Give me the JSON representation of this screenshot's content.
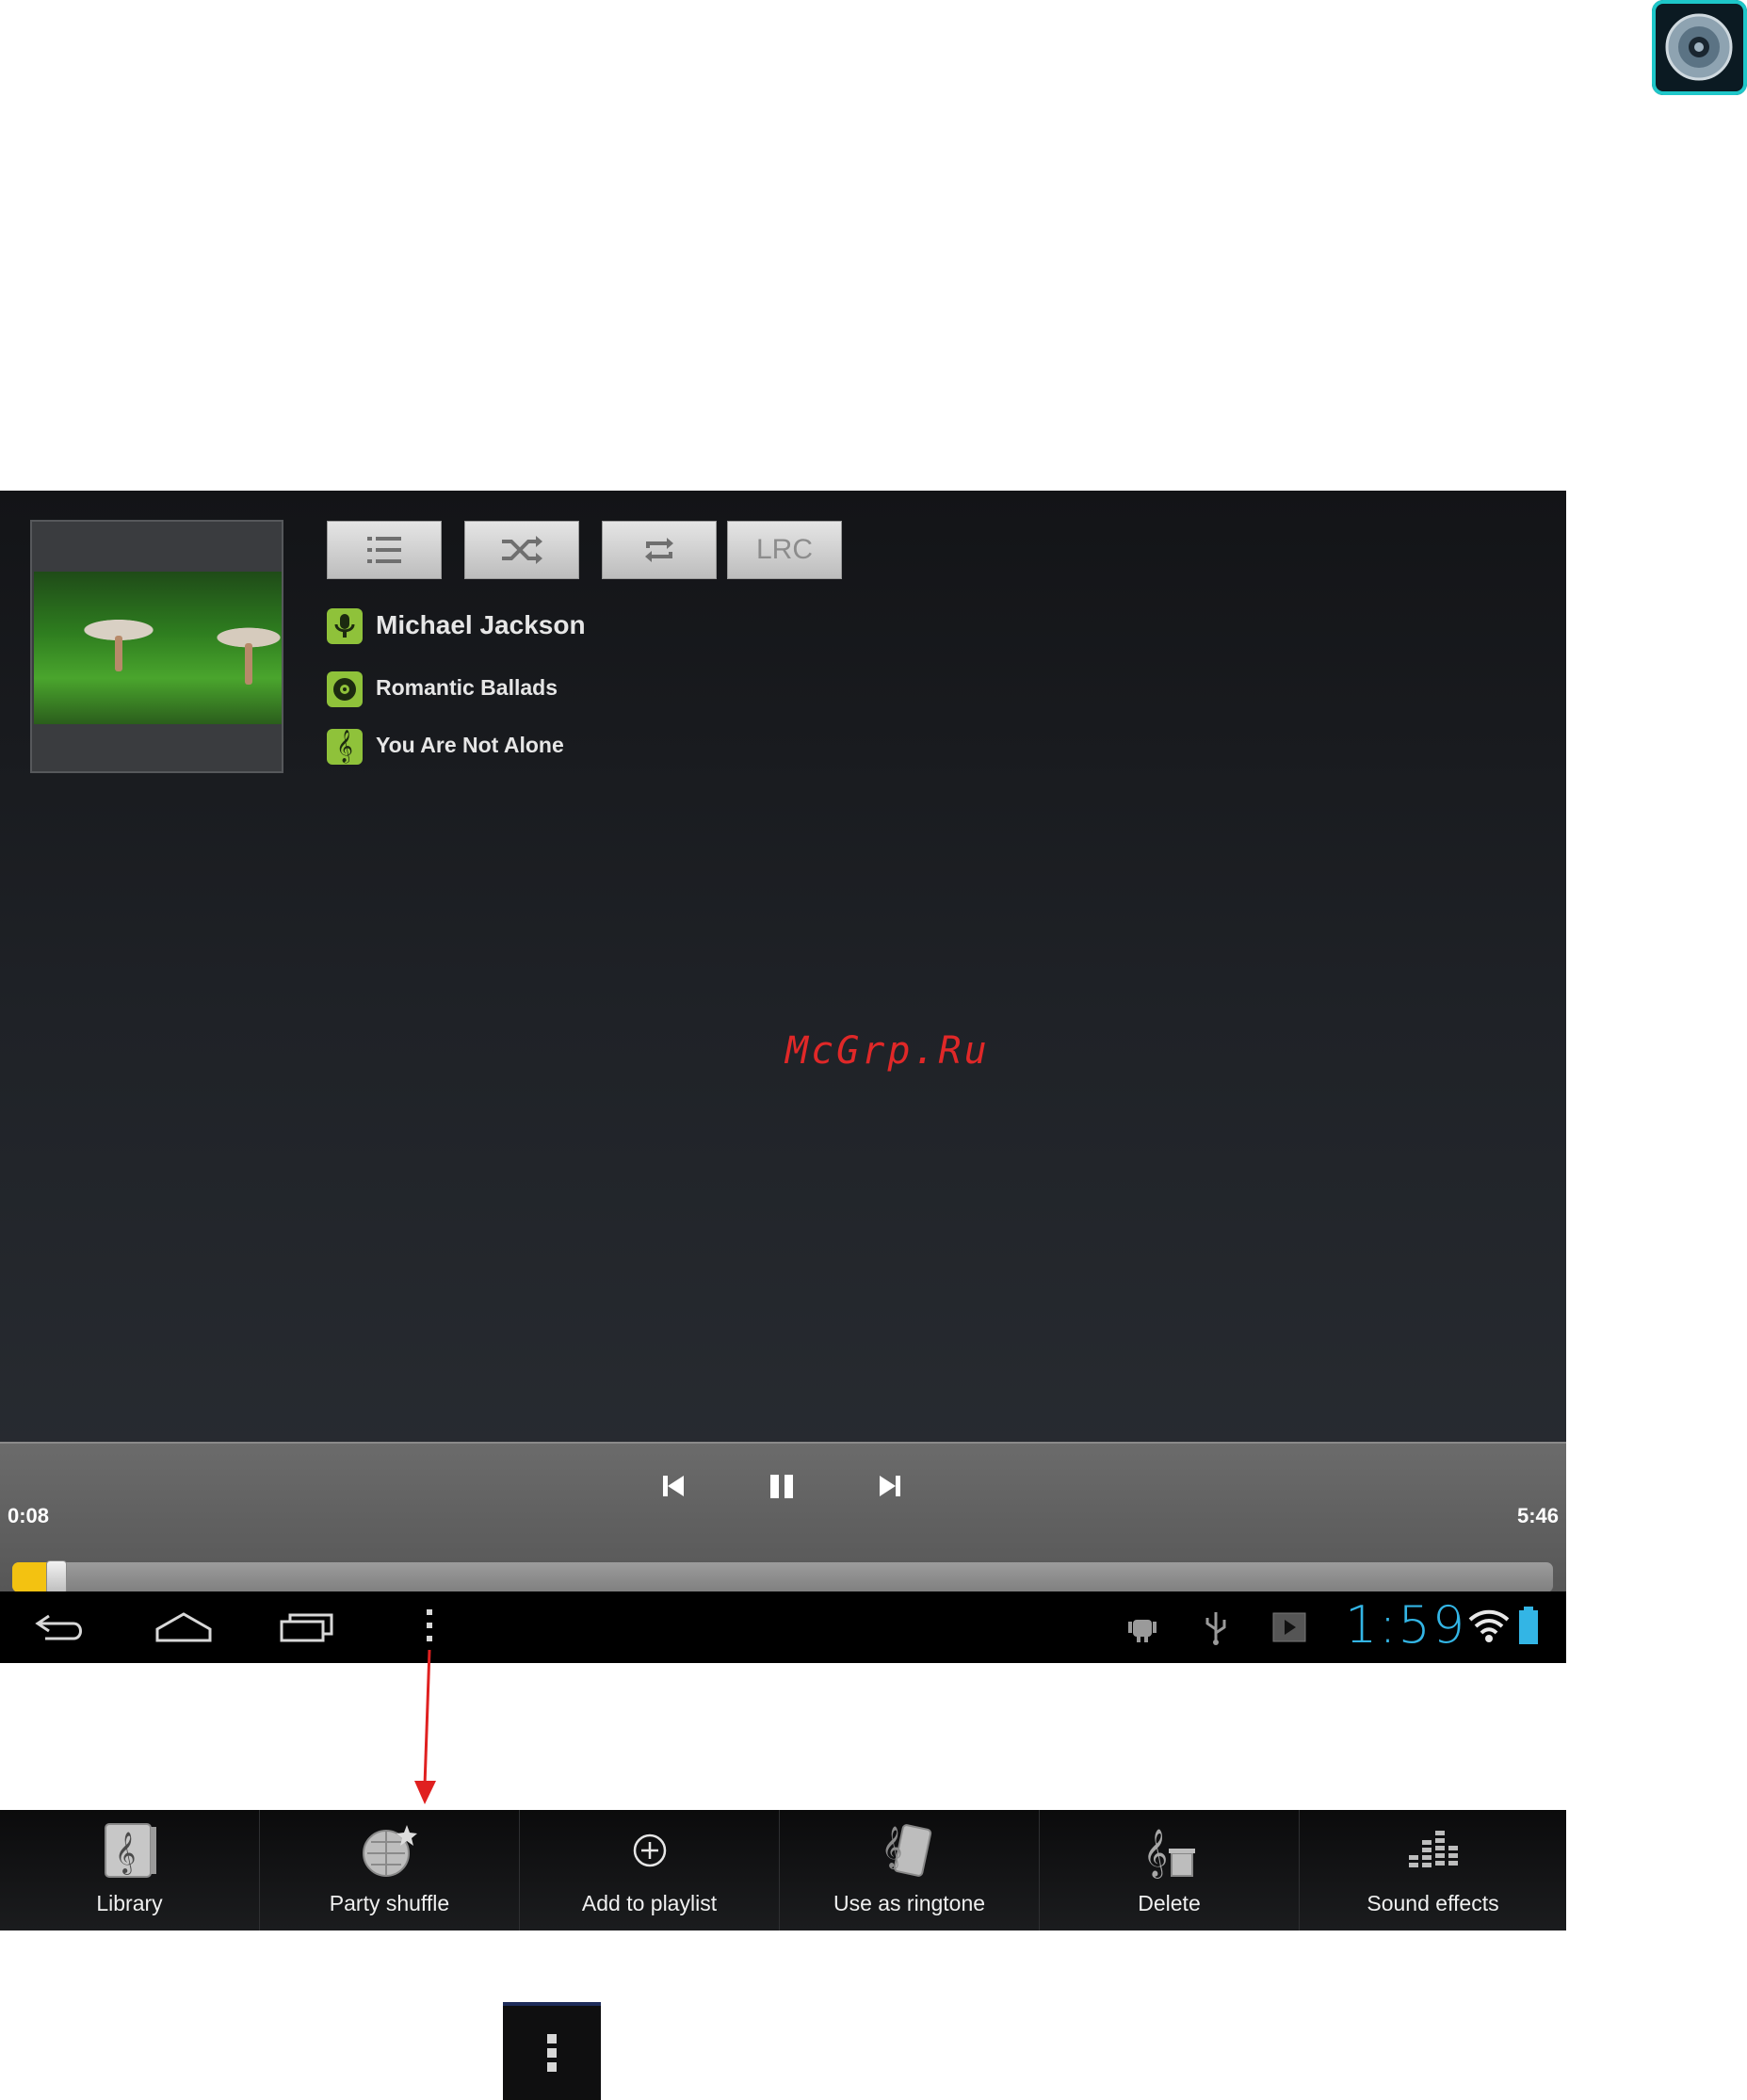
{
  "watermark": "McGrp.Ru",
  "player": {
    "toolbar": {
      "lrc_label": "LRC"
    },
    "track": {
      "artist": "Michael Jackson",
      "album": "Romantic Ballads",
      "title": "You Are Not Alone"
    },
    "time_elapsed": "0:08",
    "time_total": "5:46",
    "progress_fraction": 0.023
  },
  "system_bar": {
    "clock": "1:59"
  },
  "menu": {
    "items": [
      {
        "label": "Library",
        "icon": "library-icon"
      },
      {
        "label": "Party shuffle",
        "icon": "party-shuffle-icon"
      },
      {
        "label": "Add to playlist",
        "icon": "add-icon"
      },
      {
        "label": "Use as ringtone",
        "icon": "ringtone-icon"
      },
      {
        "label": "Delete",
        "icon": "delete-icon"
      },
      {
        "label": "Sound effects",
        "icon": "sound-effects-icon"
      }
    ]
  },
  "colors": {
    "accent_blue": "#33b5e5",
    "seek_fill": "#f3c211",
    "info_icon_green": "#8fc23a",
    "arrow_red": "#e02020"
  }
}
